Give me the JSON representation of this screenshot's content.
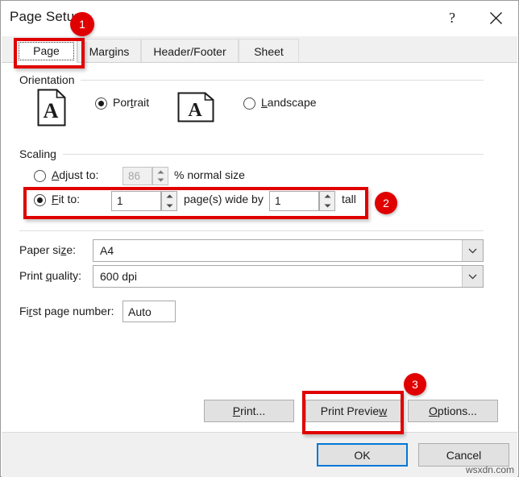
{
  "window": {
    "title": "Page Setup",
    "help_label": "?",
    "close_label": "close-icon"
  },
  "tabs": [
    {
      "label": "Page",
      "active": true
    },
    {
      "label": "Margins",
      "active": false
    },
    {
      "label": "Header/Footer",
      "active": false
    },
    {
      "label": "Sheet",
      "active": false
    }
  ],
  "orientation": {
    "group_label": "Orientation",
    "portrait": {
      "label": "Portrait",
      "selected": true
    },
    "landscape": {
      "label": "Landscape",
      "selected": false
    }
  },
  "scaling": {
    "group_label": "Scaling",
    "adjust_to": {
      "label": "Adjust to:",
      "value": "86",
      "unit": "% normal size",
      "selected": false,
      "enabled": false
    },
    "fit_to": {
      "label": "Fit to:",
      "wide_value": "1",
      "middle_unit": "page(s) wide by",
      "tall_value": "1",
      "tall_unit": "tall",
      "selected": true,
      "enabled": true
    }
  },
  "fields": {
    "paper_size": {
      "label": "Paper size:",
      "value": "A4"
    },
    "print_quality": {
      "label": "Print quality:",
      "value": "600 dpi"
    },
    "first_page_number": {
      "label": "First page number:",
      "value": "Auto"
    }
  },
  "actions": {
    "print": "Print...",
    "print_preview": "Print Preview",
    "options": "Options...",
    "ok": "OK",
    "cancel": "Cancel"
  },
  "annotations": {
    "badge1": "1",
    "badge2": "2",
    "badge3": "3",
    "accent_color": "#e00000",
    "focus_color": "#0078d7"
  },
  "watermark": "wsxdn.com"
}
